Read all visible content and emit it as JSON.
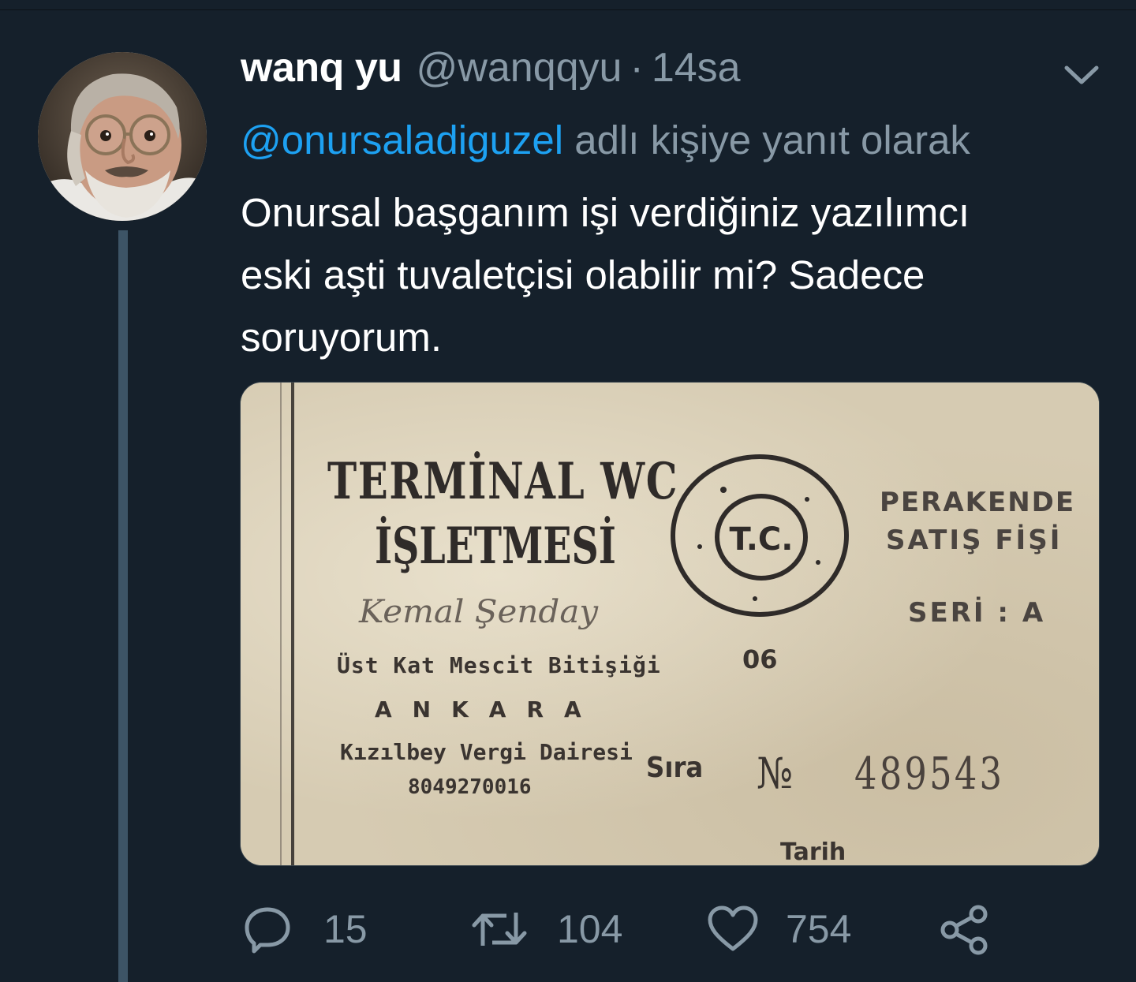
{
  "tweet": {
    "display_name": "wanq yu",
    "handle": "@wanqqyu",
    "separator": "·",
    "time": "14sa",
    "reply_mention": "@onursaladiguzel",
    "reply_suffix": " adlı kişiye yanıt olarak",
    "body_lines": [
      "Onursal başganım işi verdiğiniz yazılımcı",
      "eski aşti tuvaletçisi olabilir mi? Sadece",
      "soruyorum."
    ]
  },
  "ticket": {
    "title_line1": "TERMİNAL WC",
    "title_line2": "İŞLETMESİ",
    "signature": "Kemal Şenday",
    "address": "Üst Kat Mescit Bitişiği",
    "city": "ANKARA",
    "tax_office": "Kızılbey Vergi Dairesi",
    "tax_number": "8049270016",
    "perakende": "PERAKENDE",
    "satis_fisi": "SATIŞ FİŞİ",
    "seri": "SERİ : A",
    "stamp_center": "T.C.",
    "code": "06",
    "sira": "Sıra",
    "no_symbol": "№",
    "number": "489543",
    "tarih": "Tarih"
  },
  "actions": {
    "reply_count": "15",
    "retweet_count": "104",
    "like_count": "754"
  },
  "colors": {
    "background": "#15202b",
    "text": "#ffffff",
    "secondary": "#8899a6",
    "link": "#1da1f2",
    "thread_line": "#3d5466"
  }
}
